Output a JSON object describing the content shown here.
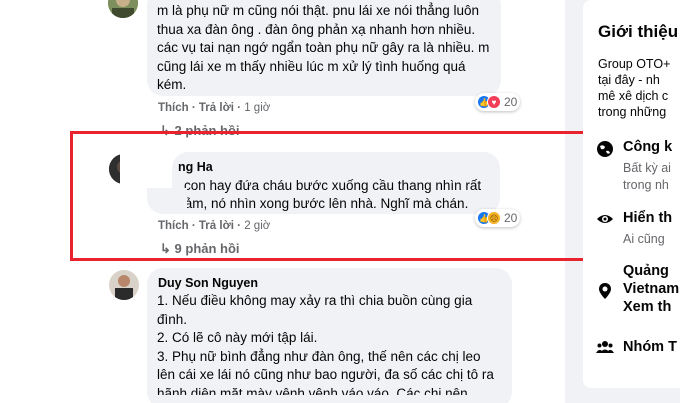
{
  "comments": [
    {
      "name": "",
      "lines": [
        "m là phụ nữ m cũng nói thật. pnu lái xe nói thẳng luôn",
        "thua xa đàn ông . đàn ông phản xạ nhanh hơn nhiều.",
        "các vụ tai nạn ngớ ngẩn toàn phụ nữ gây ra là nhiều. m",
        "cũng lái xe m thấy nhiều lúc m xử lý tình huống quá",
        "kém."
      ],
      "like": "Thích",
      "reply": "Trả lời",
      "time": "1 giờ",
      "reaction_count": "20",
      "replies": "2 phản hồi"
    },
    {
      "name": "ng Ha",
      "lines": [
        "con hay đứa cháu bước xuống cầu thang nhìn rất",
        "vô cảm, nó nhìn xong bước lên nhà. Nghĩ mà chán."
      ],
      "like": "Thích",
      "reply": "Trả lời",
      "time": "2 giờ",
      "reaction_count": "20",
      "replies": "9 phản hồi"
    },
    {
      "name": "Duy Son Nguyen",
      "lines": [
        "1. Nếu điều không may xảy ra thì chia buồn cùng gia",
        "đình.",
        "2. Có lẽ cô này mới tập lái.",
        "3. Phụ nữ bình đẳng như đàn ông, thế nên các chị leo",
        "lên cái xe lái nó cũng như bao người, đa số các chị tô ra",
        "hãnh diện mặt mày vênh vênh váo váo. Các chị nên"
      ]
    }
  ],
  "dot": "·",
  "about": {
    "title": "Giới thiệu",
    "desc": [
      "Group OTO+",
      "tại đây - nh",
      "mê xê dịch c",
      "trong những"
    ],
    "items": [
      {
        "head": "Công k",
        "sub": [
          "Bất kỳ ai",
          "trong nh"
        ]
      },
      {
        "head": "Hiển th",
        "sub": [
          "Ai cũng"
        ]
      },
      {
        "head": "Quảng",
        "sub2": [
          "Vietnam",
          "Xem th"
        ]
      },
      {
        "head": "Nhóm T"
      }
    ]
  }
}
